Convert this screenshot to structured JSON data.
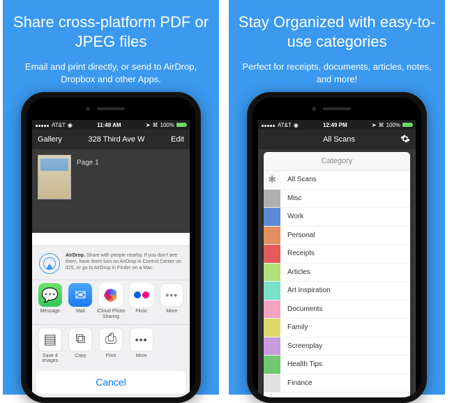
{
  "left": {
    "headline": "Share cross-platform PDF or JPEG files",
    "subhead": "Email and print directly, or send to AirDrop, Dropbox and other Apps.",
    "statusbar": {
      "carrier": "AT&T",
      "time": "11:48 AM",
      "battery": "100%"
    },
    "navbar": {
      "left": "Gallery",
      "title": "328 Third Ave W",
      "right": "Edit"
    },
    "page_label": "Page 1",
    "airdrop": {
      "title": "AirDrop.",
      "body": "Share with people nearby. If you don't see them, have them turn on AirDrop in Control Center on iOS, or go to AirDrop in Finder on a Mac."
    },
    "share_apps": [
      {
        "name": "message-icon",
        "label": "Message"
      },
      {
        "name": "mail-icon",
        "label": "Mail"
      },
      {
        "name": "icloud-photo-icon",
        "label": "iCloud Photo Sharing"
      },
      {
        "name": "flickr-icon",
        "label": "Flickr"
      },
      {
        "name": "more-icon",
        "label": "More"
      }
    ],
    "share_actions": [
      {
        "name": "save-images-icon",
        "label": "Save 4 Images"
      },
      {
        "name": "copy-icon",
        "label": "Copy"
      },
      {
        "name": "print-icon",
        "label": "Print"
      },
      {
        "name": "more-icon",
        "label": "More"
      }
    ],
    "cancel": "Cancel"
  },
  "right": {
    "headline": "Stay Organized with easy-to-use categories",
    "subhead": "Perfect for receipts, documents, articles, notes, and more!",
    "statusbar": {
      "carrier": "AT&T",
      "time": "12:49 PM",
      "battery": "100%"
    },
    "navbar": {
      "title": "All Scans"
    },
    "popover_title": "Category",
    "categories": [
      {
        "label": "All Scans",
        "color": "star"
      },
      {
        "label": "Misc",
        "color": "#b0b0b0"
      },
      {
        "label": "Work",
        "color": "#5b8bd4"
      },
      {
        "label": "Personal",
        "color": "#e08f5f"
      },
      {
        "label": "Receipts",
        "color": "#e35b5b"
      },
      {
        "label": "Articles",
        "color": "#b2e07a"
      },
      {
        "label": "Art Inspiration",
        "color": "#7de0c8"
      },
      {
        "label": "Documents",
        "color": "#f4a3c0"
      },
      {
        "label": "Family",
        "color": "#e0d96a"
      },
      {
        "label": "Screenplay",
        "color": "#c89be0"
      },
      {
        "label": "Health Tips",
        "color": "#6fc96f"
      },
      {
        "label": "Finance",
        "color": "#e0e0e0"
      }
    ]
  }
}
